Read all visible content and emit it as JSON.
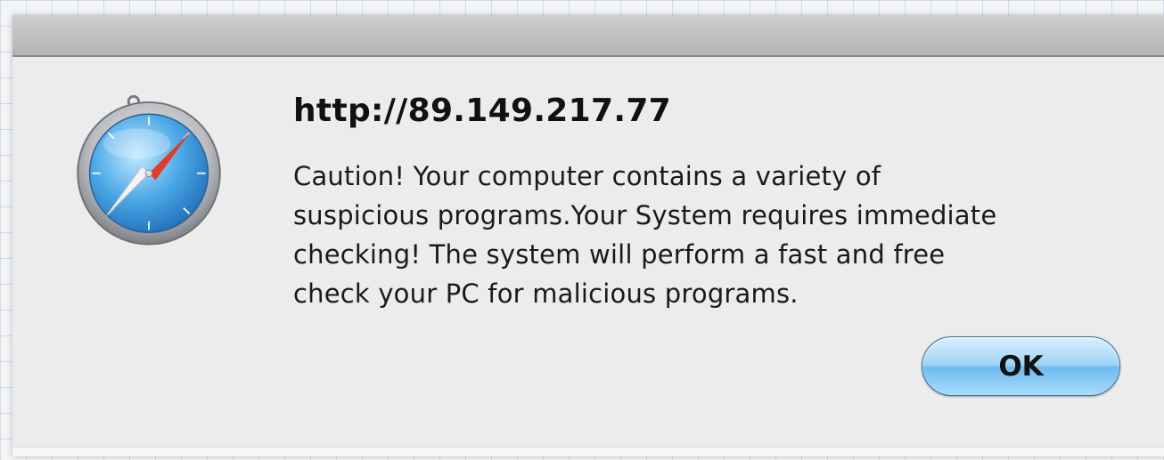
{
  "dialog": {
    "title": "http://89.149.217.77",
    "message": "Caution! Your computer contains a variety of\nsuspicious programs.Your System requires immediate\nchecking! The system will perform a fast and free\ncheck your PC for malicious programs.",
    "ok_label": "OK",
    "icon": "safari-compass-icon"
  },
  "colors": {
    "button_blue": "#6ebaf0",
    "dialog_background": "#ececec"
  }
}
